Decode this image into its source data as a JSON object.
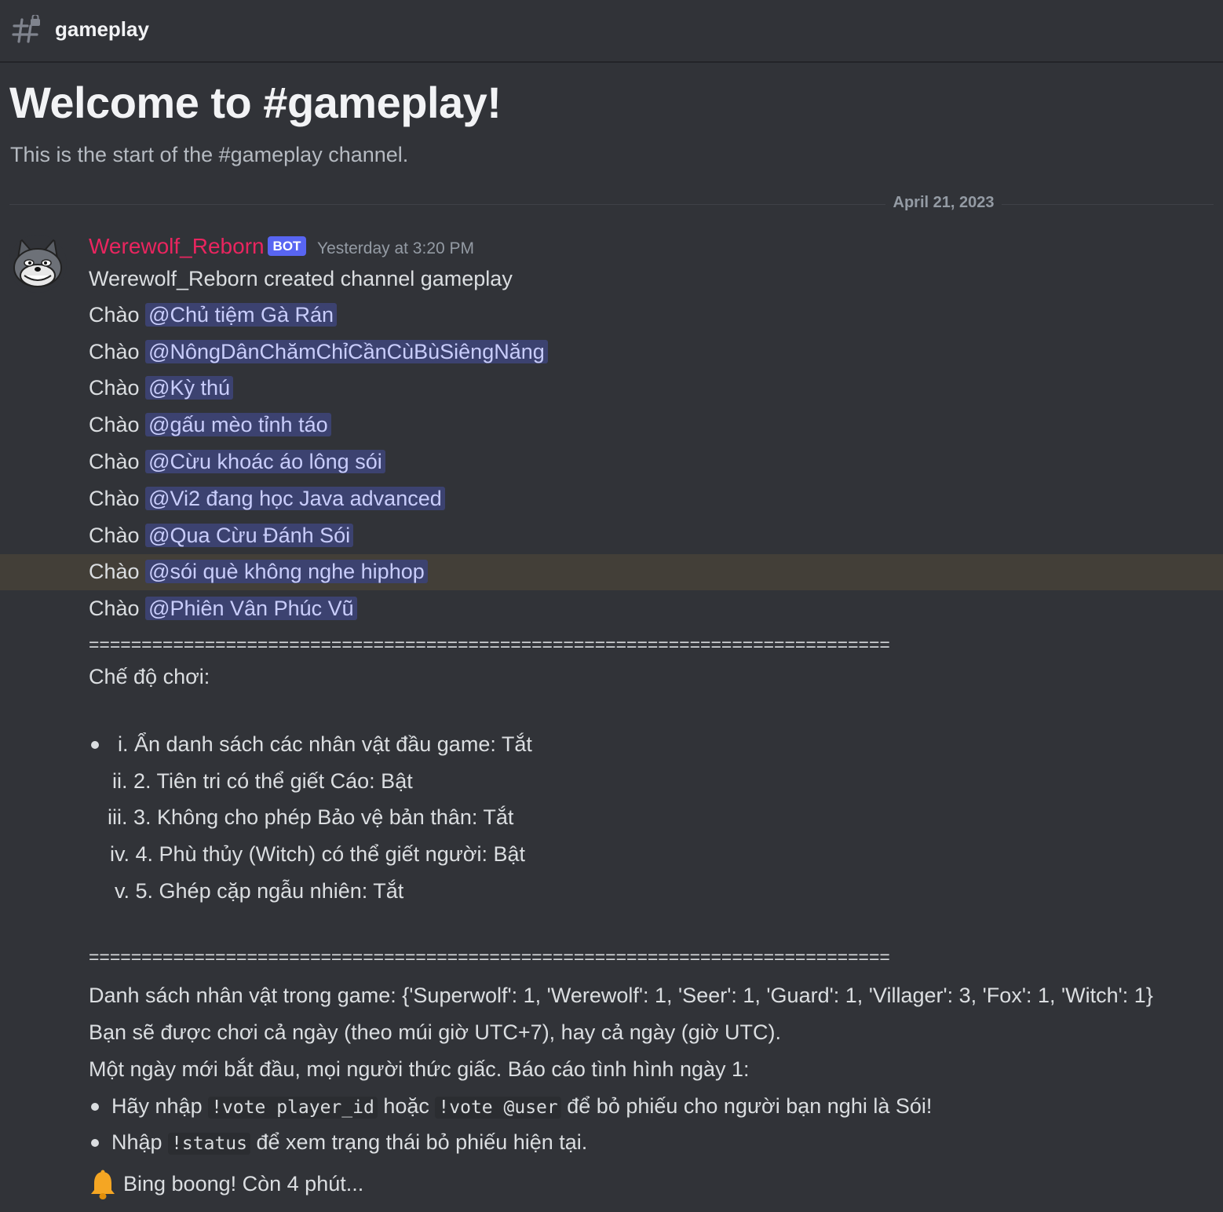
{
  "header": {
    "channel_name": "gameplay",
    "icon": "hashtag-lock-icon"
  },
  "welcome": {
    "title": "Welcome to #gameplay!",
    "subtitle": "This is the start of the #gameplay channel."
  },
  "date_divider": "April 21, 2023",
  "message": {
    "author": "Werewolf_Reborn",
    "badge": "BOT",
    "timestamp": "Yesterday at 3:20 PM",
    "created_line": "Werewolf_Reborn created channel gameplay",
    "greeting_word": "Chào",
    "greetings": [
      "@Chủ tiệm Gà Rán",
      "@NôngDânChămChỉCầnCùBùSiêngNăng",
      "@Kỳ thú",
      "@gấu mèo tỉnh táo",
      "@Cừu khoác áo lông sói",
      "@Vi2 đang học Java advanced",
      "@Qua Cừu Đánh Sói",
      "@sói què không nghe hiphop",
      "@Phiên Vân Phúc Vũ"
    ],
    "separator": "============================================================================",
    "mode_title": "Chế độ chơi:",
    "modes": [
      {
        "marker": "i.",
        "text": "Ẩn danh sách các nhân vật đầu game: Tắt"
      },
      {
        "marker": "ii.",
        "text": "2. Tiên tri có thể giết Cáo: Bật"
      },
      {
        "marker": "iii.",
        "text": "3. Không cho phép Bảo vệ bản thân: Tắt"
      },
      {
        "marker": "iv.",
        "text": "4. Phù thủy (Witch) có thể giết người: Bật"
      },
      {
        "marker": "v.",
        "text": "5. Ghép cặp ngẫu nhiên: Tắt"
      }
    ],
    "roles_line": "Danh sách nhân vật trong game: {'Superwolf': 1, 'Werewolf': 1, 'Seer': 1, 'Guard': 1, 'Villager': 3, 'Fox': 1, 'Witch': 1}",
    "play_line": "Bạn sẽ được chơi cả ngày (theo múi giờ UTC+7), hay cả ngày (giờ UTC).",
    "day_line": "Một ngày mới bắt đầu, mọi người thức giấc. Báo cáo tình hình ngày 1:",
    "vote": {
      "prefix": "Hãy nhập",
      "code1": "!vote player_id",
      "middle": "hoặc",
      "code2": "!vote @user",
      "suffix": "để bỏ phiếu cho người bạn nghi là Sói!"
    },
    "status": {
      "prefix": "Nhập",
      "code": "!status",
      "suffix": "để xem trạng thái bỏ phiếu hiện tại."
    },
    "bell_line": "Bing boong! Còn 4 phút..."
  },
  "colors": {
    "background": "#313338",
    "author": "#e9255f",
    "mention_bg": "#3c4270",
    "highlight_row": "#433f38",
    "bot_badge": "#5865f2"
  }
}
